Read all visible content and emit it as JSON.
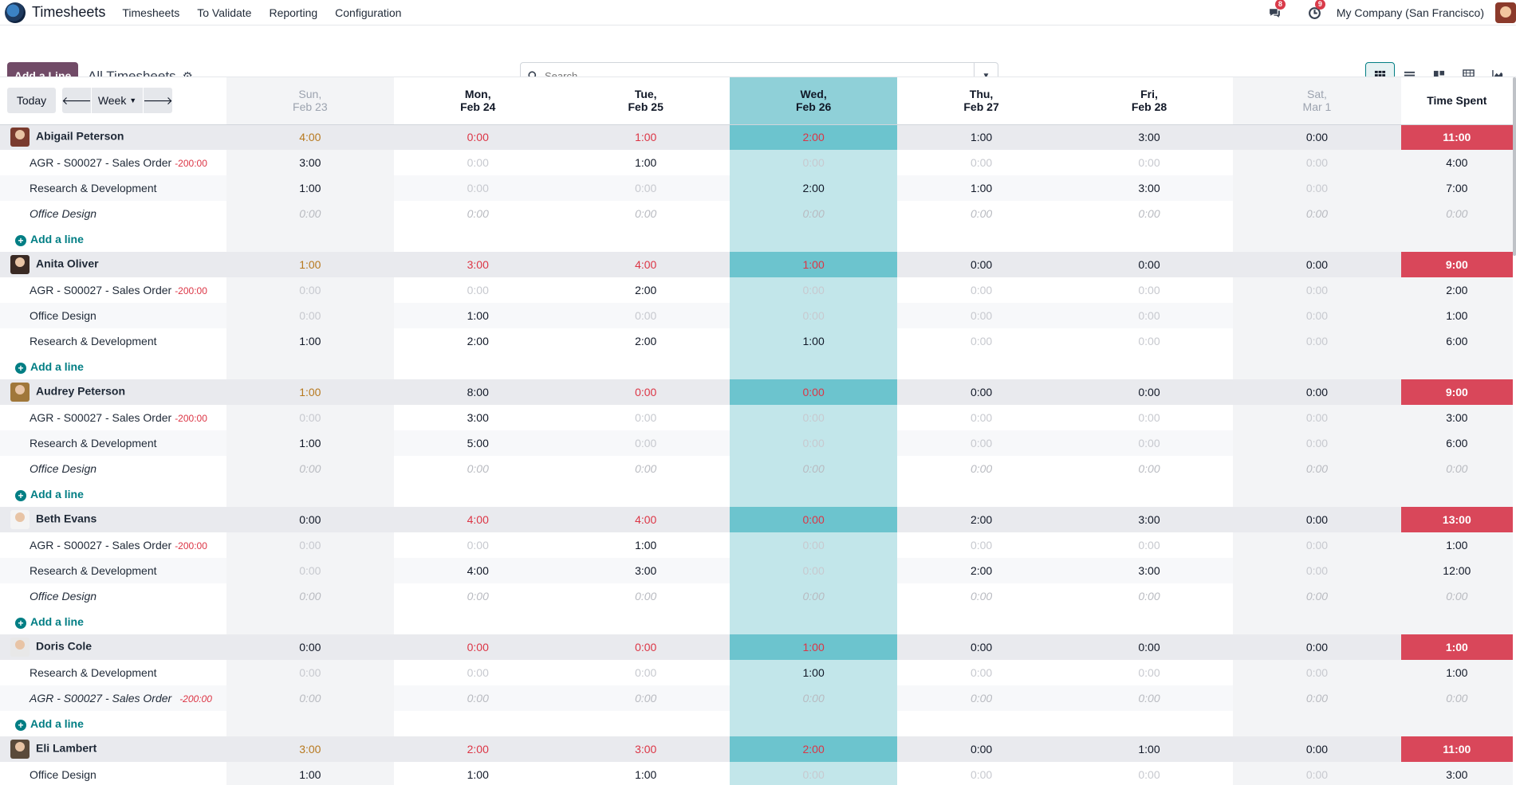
{
  "app": {
    "name": "Timesheets",
    "menus": [
      "Timesheets",
      "To Validate",
      "Reporting",
      "Configuration"
    ],
    "messages_badge": "8",
    "activities_badge": "9",
    "company": "My Company (San Francisco)"
  },
  "control": {
    "add_line": "Add a Line",
    "title": "All Timesheets",
    "search_placeholder": "Search...",
    "views": [
      "grid-icon",
      "list-icon",
      "kanban-icon",
      "pivot-icon",
      "graph-icon"
    ]
  },
  "nav": {
    "today": "Today",
    "range": "Week"
  },
  "header": {
    "days": [
      {
        "l1": "Sun,",
        "l2": "Feb 23",
        "kind": "weekend"
      },
      {
        "l1": "Mon,",
        "l2": "Feb 24",
        "kind": "day"
      },
      {
        "l1": "Tue,",
        "l2": "Feb 25",
        "kind": "day"
      },
      {
        "l1": "Wed,",
        "l2": "Feb 26",
        "kind": "today"
      },
      {
        "l1": "Thu,",
        "l2": "Feb 27",
        "kind": "day"
      },
      {
        "l1": "Fri,",
        "l2": "Feb 28",
        "kind": "day"
      },
      {
        "l1": "Sat,",
        "l2": "Mar 1",
        "kind": "weekend"
      }
    ],
    "total": "Time Spent"
  },
  "add_a_line": "Add a line",
  "groups": [
    {
      "name": "Abigail Peterson",
      "avatar_color": "#7a3b2e",
      "totals": [
        [
          "4:00",
          "orange"
        ],
        [
          "0:00",
          "red"
        ],
        [
          "1:00",
          "red"
        ],
        [
          "2:00",
          "red"
        ],
        [
          "1:00",
          "dark"
        ],
        [
          "3:00",
          "dark"
        ],
        [
          "0:00",
          "dark"
        ]
      ],
      "total": "11:00",
      "lines": [
        {
          "name": "AGR - S00027 - Sales Order",
          "tag": "-200:00",
          "values": [
            "3:00",
            "0:00",
            "1:00",
            "0:00",
            "0:00",
            "0:00",
            "0:00"
          ],
          "total": "4:00"
        },
        {
          "name": "Research & Development",
          "values": [
            "1:00",
            "0:00",
            "0:00",
            "2:00",
            "1:00",
            "3:00",
            "0:00"
          ],
          "total": "7:00"
        },
        {
          "name": "Office Design",
          "italic": true,
          "values": [
            "0:00",
            "0:00",
            "0:00",
            "0:00",
            "0:00",
            "0:00",
            "0:00"
          ],
          "total": "0:00"
        }
      ]
    },
    {
      "name": "Anita Oliver",
      "avatar_color": "#3a2a24",
      "totals": [
        [
          "1:00",
          "orange"
        ],
        [
          "3:00",
          "red"
        ],
        [
          "4:00",
          "red"
        ],
        [
          "1:00",
          "red"
        ],
        [
          "0:00",
          "dark"
        ],
        [
          "0:00",
          "dark"
        ],
        [
          "0:00",
          "dark"
        ]
      ],
      "total": "9:00",
      "lines": [
        {
          "name": "AGR - S00027 - Sales Order",
          "tag": "-200:00",
          "values": [
            "0:00",
            "0:00",
            "2:00",
            "0:00",
            "0:00",
            "0:00",
            "0:00"
          ],
          "total": "2:00"
        },
        {
          "name": "Office Design",
          "values": [
            "0:00",
            "1:00",
            "0:00",
            "0:00",
            "0:00",
            "0:00",
            "0:00"
          ],
          "total": "1:00"
        },
        {
          "name": "Research & Development",
          "values": [
            "1:00",
            "2:00",
            "2:00",
            "1:00",
            "0:00",
            "0:00",
            "0:00"
          ],
          "total": "6:00"
        }
      ]
    },
    {
      "name": "Audrey Peterson",
      "avatar_color": "#a0773a",
      "totals": [
        [
          "1:00",
          "orange"
        ],
        [
          "8:00",
          "dark"
        ],
        [
          "0:00",
          "red"
        ],
        [
          "0:00",
          "red"
        ],
        [
          "0:00",
          "dark"
        ],
        [
          "0:00",
          "dark"
        ],
        [
          "0:00",
          "dark"
        ]
      ],
      "total": "9:00",
      "lines": [
        {
          "name": "AGR - S00027 - Sales Order",
          "tag": "-200:00",
          "values": [
            "0:00",
            "3:00",
            "0:00",
            "0:00",
            "0:00",
            "0:00",
            "0:00"
          ],
          "total": "3:00"
        },
        {
          "name": "Research & Development",
          "values": [
            "1:00",
            "5:00",
            "0:00",
            "0:00",
            "0:00",
            "0:00",
            "0:00"
          ],
          "total": "6:00"
        },
        {
          "name": "Office Design",
          "italic": true,
          "values": [
            "0:00",
            "0:00",
            "0:00",
            "0:00",
            "0:00",
            "0:00",
            "0:00"
          ],
          "total": "0:00"
        }
      ]
    },
    {
      "name": "Beth Evans",
      "avatar_color": "#f4f4f4",
      "totals": [
        [
          "0:00",
          "dark"
        ],
        [
          "4:00",
          "red"
        ],
        [
          "4:00",
          "red"
        ],
        [
          "0:00",
          "red"
        ],
        [
          "2:00",
          "dark"
        ],
        [
          "3:00",
          "dark"
        ],
        [
          "0:00",
          "dark"
        ]
      ],
      "total": "13:00",
      "lines": [
        {
          "name": "AGR - S00027 - Sales Order",
          "tag": "-200:00",
          "values": [
            "0:00",
            "0:00",
            "1:00",
            "0:00",
            "0:00",
            "0:00",
            "0:00"
          ],
          "total": "1:00"
        },
        {
          "name": "Research & Development",
          "values": [
            "0:00",
            "4:00",
            "3:00",
            "0:00",
            "2:00",
            "3:00",
            "0:00"
          ],
          "total": "12:00"
        },
        {
          "name": "Office Design",
          "italic": true,
          "values": [
            "0:00",
            "0:00",
            "0:00",
            "0:00",
            "0:00",
            "0:00",
            "0:00"
          ],
          "total": "0:00"
        }
      ]
    },
    {
      "name": "Doris Cole",
      "avatar_color": "#e8e8e8",
      "totals": [
        [
          "0:00",
          "dark"
        ],
        [
          "0:00",
          "red"
        ],
        [
          "0:00",
          "red"
        ],
        [
          "1:00",
          "red"
        ],
        [
          "0:00",
          "dark"
        ],
        [
          "0:00",
          "dark"
        ],
        [
          "0:00",
          "dark"
        ]
      ],
      "total": "1:00",
      "lines": [
        {
          "name": "Research & Development",
          "values": [
            "0:00",
            "0:00",
            "0:00",
            "1:00",
            "0:00",
            "0:00",
            "0:00"
          ],
          "total": "1:00"
        },
        {
          "name": "AGR - S00027 - Sales Order",
          "tag": "-200:00",
          "italic": true,
          "values": [
            "0:00",
            "0:00",
            "0:00",
            "0:00",
            "0:00",
            "0:00",
            "0:00"
          ],
          "total": "0:00"
        }
      ]
    },
    {
      "name": "Eli Lambert",
      "avatar_color": "#5a4a3a",
      "totals": [
        [
          "3:00",
          "orange"
        ],
        [
          "2:00",
          "red"
        ],
        [
          "3:00",
          "red"
        ],
        [
          "2:00",
          "red"
        ],
        [
          "0:00",
          "dark"
        ],
        [
          "1:00",
          "dark"
        ],
        [
          "0:00",
          "dark"
        ]
      ],
      "total": "11:00",
      "lines": [
        {
          "name": "Office Design",
          "values": [
            "1:00",
            "1:00",
            "1:00",
            "0:00",
            "0:00",
            "0:00",
            "0:00"
          ],
          "total": "3:00"
        }
      ]
    }
  ]
}
